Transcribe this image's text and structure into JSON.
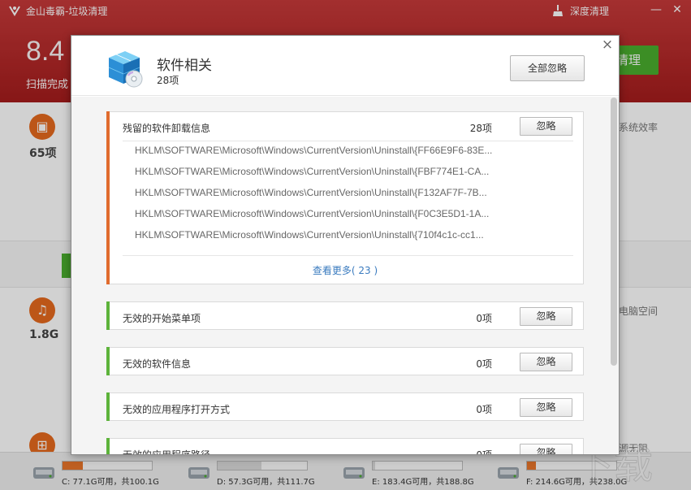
{
  "app": {
    "title": "金山毒霸-垃圾清理",
    "deep_clean": "深度清理",
    "big_size": "8.4",
    "scan_status": "扫描完成",
    "bg_button": "清理",
    "categories": [
      {
        "count": "65项"
      },
      {
        "count": "1.8G"
      }
    ],
    "side_texts": [
      "系统效率",
      "电脑空间",
      "源无阻"
    ]
  },
  "disks": [
    {
      "label": "C: 77.1G可用，共100.1G",
      "fill_fraction": 0.23,
      "fill_color": "#e8742a"
    },
    {
      "label": "D: 57.3G可用，共111.7G",
      "fill_fraction": 0.49,
      "fill_color": "#d9d9d9"
    },
    {
      "label": "E: 183.4G可用，共188.8G",
      "fill_fraction": 0.03,
      "fill_color": "#d9d9d9"
    },
    {
      "label": "F: 214.6G可用，共238.0G",
      "fill_fraction": 0.1,
      "fill_color": "#e8742a"
    }
  ],
  "dialog": {
    "title": "软件相关",
    "count": "28项",
    "ignore_all": "全部忽略",
    "close": "×",
    "sections": [
      {
        "title": "残留的软件卸载信息",
        "count": "28项",
        "button": "忽略",
        "accent": "#e06b2d",
        "items": [
          "HKLM\\SOFTWARE\\Microsoft\\Windows\\CurrentVersion\\Uninstall\\{FF66E9F6-83E...",
          "HKLM\\SOFTWARE\\Microsoft\\Windows\\CurrentVersion\\Uninstall\\{FBF774E1-CA...",
          "HKLM\\SOFTWARE\\Microsoft\\Windows\\CurrentVersion\\Uninstall\\{F132AF7F-7B...",
          "HKLM\\SOFTWARE\\Microsoft\\Windows\\CurrentVersion\\Uninstall\\{F0C3E5D1-1A...",
          "HKLM\\SOFTWARE\\Microsoft\\Windows\\CurrentVersion\\Uninstall\\{710f4c1c-cc1..."
        ],
        "more": "查看更多( 23 )"
      },
      {
        "title": "无效的开始菜单项",
        "count": "0项",
        "button": "忽略",
        "accent": "#5db33b"
      },
      {
        "title": "无效的软件信息",
        "count": "0项",
        "button": "忽略",
        "accent": "#5db33b"
      },
      {
        "title": "无效的应用程序打开方式",
        "count": "0项",
        "button": "忽略",
        "accent": "#5db33b"
      },
      {
        "title": "无效的应用程序路径",
        "count": "0项",
        "button": "忽略",
        "accent": "#5db33b"
      }
    ]
  },
  "colors": {
    "header_red": "#b52a2a",
    "accent_orange": "#e06b2d",
    "accent_green": "#5db33b",
    "link_blue": "#3a7bbf"
  }
}
